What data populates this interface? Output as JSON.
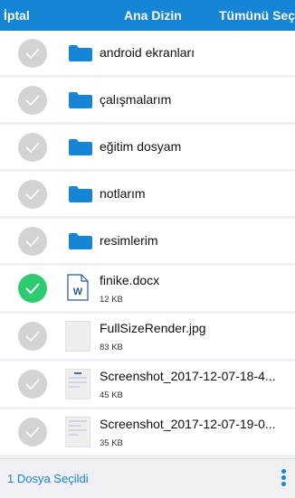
{
  "topbar": {
    "cancel_label": "İptal",
    "title": "Ana Dizin",
    "select_all_label": "Tümünü Seç"
  },
  "items": [
    {
      "name": "android ekranları",
      "type": "folder",
      "checked": false
    },
    {
      "name": "çalışmalarım",
      "type": "folder",
      "checked": false
    },
    {
      "name": "eğitim dosyam",
      "type": "folder",
      "checked": false
    },
    {
      "name": "notlarım",
      "type": "folder",
      "checked": false
    },
    {
      "name": "resimlerim",
      "type": "folder",
      "checked": false
    },
    {
      "name": "finike.docx",
      "type": "file",
      "size": "12 KB",
      "icon": "word-doc-icon",
      "checked": true
    },
    {
      "name": "FullSizeRender.jpg",
      "type": "file",
      "size": "83 KB",
      "icon": "image-thumbnail",
      "checked": false
    },
    {
      "name": "Screenshot_2017-12-07-18-4...",
      "type": "file",
      "size": "45 KB",
      "icon": "screenshot-thumbnail",
      "checked": false
    },
    {
      "name": "Screenshot_2017-12-07-19-0...",
      "type": "file",
      "size": "35 KB",
      "icon": "screenshot-thumbnail",
      "checked": false
    }
  ],
  "bottombar": {
    "selection_status": "1 Dosya Seçildi",
    "more_icon": "more-vertical-icon"
  },
  "colors": {
    "accent": "#1685d6",
    "selected": "#2ecc71",
    "unselected": "#d3d3d6",
    "folder": "#1685d6"
  }
}
